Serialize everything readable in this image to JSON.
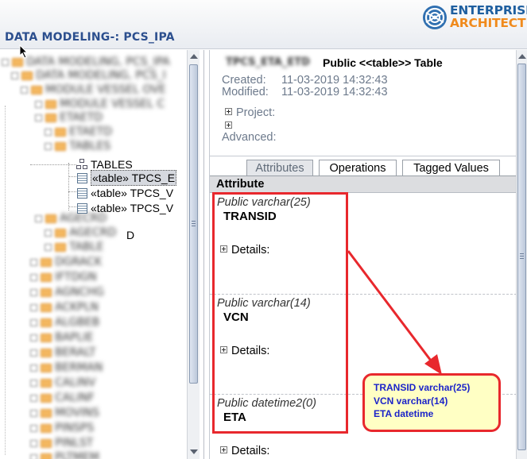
{
  "header": {
    "title": "DATA MODELING-: PCS_IPA",
    "logo_line1": "ENTERPRISE",
    "logo_line2": "ARCHITECT"
  },
  "tree": {
    "blurred_rows": [
      "DATA MODELING, PCS_IPA",
      "DATA MODELING, PCS_I",
      "MODULE VESSEL OVE",
      "MODULE VESSEL C",
      "ETAETD",
      "ETAETD",
      "TABLES",
      "AGECRD",
      "AGECRD",
      "TABLE",
      "DGRACK",
      "IFTDGN",
      "AGNCHG",
      "ACKPLN",
      "ALGBEB",
      "BAPLIE",
      "BERALT",
      "BERMAN",
      "CALINV",
      "CALINF",
      "MOVINS",
      "PINSPS",
      "PINLST",
      "PLTMEM"
    ],
    "package_label": "TABLES",
    "items": [
      {
        "label": "«table» TPCS_E",
        "selected": true
      },
      {
        "label": "«table» TPCS_V",
        "selected": false
      },
      {
        "label": "«table» TPCS_V",
        "selected": false
      }
    ],
    "partial_label": "D"
  },
  "details": {
    "element_name": "TPCS_ETA_ETD",
    "heading": "Public <<table>> Table",
    "created_label": "Created:",
    "created_value": "11-03-2019 14:32:43",
    "modified_label": "Modified:",
    "modified_value": "11-03-2019 14:32:43",
    "project_label": "Project:",
    "advanced_label": "Advanced:",
    "tabs": [
      "Attributes",
      "Operations",
      "Tagged Values"
    ],
    "active_tab": "Attributes",
    "attribute_header": "Attribute",
    "attributes": [
      {
        "signature": "Public varchar(25)",
        "name": "TRANSID",
        "details_label": "Details:"
      },
      {
        "signature": "Public varchar(14)",
        "name": "VCN",
        "details_label": "Details:"
      },
      {
        "signature": "Public datetime2(0)",
        "name": "ETA",
        "details_label": "Details:"
      }
    ]
  },
  "callout": {
    "lines": [
      "TRANSID varchar(25)",
      "VCN varchar(14)",
      "ETA datetime"
    ]
  },
  "colors": {
    "title_blue": "#2c4f8e",
    "annotation_red": "#e8282d",
    "callout_fill": "#ffffc4",
    "callout_text": "#1b23c9",
    "logo_blue": "#1f5f9f",
    "logo_orange": "#f08a1c"
  }
}
